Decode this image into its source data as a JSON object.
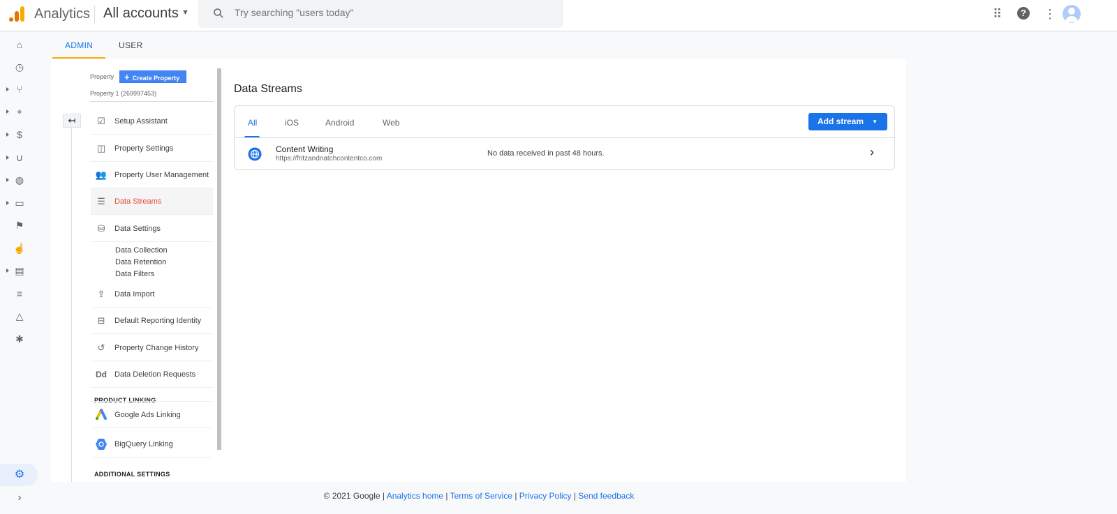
{
  "header": {
    "brand": "Analytics",
    "account": "All accounts",
    "search_placeholder": "Try searching \"users today\""
  },
  "tabs": {
    "admin": "ADMIN",
    "user": "USER"
  },
  "property": {
    "label": "Property",
    "create": "Create Property",
    "name": "Property 1 (269997453)"
  },
  "menu": [
    {
      "label": "Setup Assistant",
      "icon": "checklist-icon"
    },
    {
      "label": "Property Settings",
      "icon": "layout-icon"
    },
    {
      "label": "Property User Management",
      "icon": "people-icon"
    },
    {
      "label": "Data Streams",
      "icon": "streams-icon",
      "active": true
    },
    {
      "label": "Data Settings",
      "icon": "database-icon"
    },
    {
      "label": "Data Import",
      "icon": "upload-icon"
    },
    {
      "label": "Default Reporting Identity",
      "icon": "identity-icon"
    },
    {
      "label": "Property Change History",
      "icon": "history-icon"
    },
    {
      "label": "Data Deletion Requests",
      "icon": "dd-icon"
    }
  ],
  "data_settings_sub": [
    "Data Collection",
    "Data Retention",
    "Data Filters"
  ],
  "product_linking": {
    "heading": "PRODUCT LINKING",
    "items": [
      "Google Ads Linking",
      "BigQuery Linking"
    ]
  },
  "additional_settings": "ADDITIONAL SETTINGS",
  "main": {
    "title": "Data Streams",
    "tabs": [
      "All",
      "iOS",
      "Android",
      "Web"
    ],
    "active_tab": "All",
    "add_stream": "Add stream",
    "streams": [
      {
        "name": "Content Writing",
        "url": "https://fritzandnatchcontentco.com",
        "status": "No data received in past 48 hours."
      }
    ]
  },
  "footer": {
    "copyright": "© 2021 Google",
    "links": [
      "Analytics home",
      "Terms of Service",
      "Privacy Policy",
      "Send feedback"
    ]
  },
  "colors": {
    "accent": "#1a73e8",
    "active_menu": "#e8453c",
    "tab_underline": "#f9ab00"
  }
}
